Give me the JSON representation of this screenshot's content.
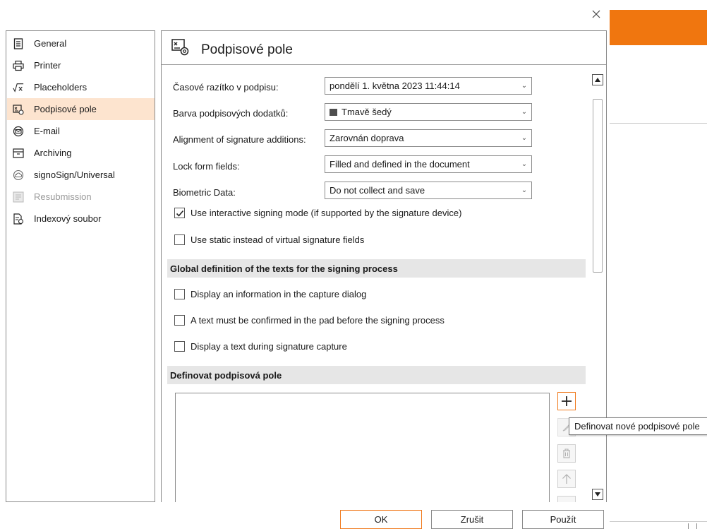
{
  "dialog": {
    "close_label": "×"
  },
  "nav": {
    "items": [
      {
        "label": "General",
        "icon": "general-icon"
      },
      {
        "label": "Printer",
        "icon": "printer-icon"
      },
      {
        "label": "Placeholders",
        "icon": "formula-icon"
      },
      {
        "label": "Podpisové pole",
        "icon": "signature-field-icon",
        "selected": true
      },
      {
        "label": "E-mail",
        "icon": "email-icon"
      },
      {
        "label": "Archiving",
        "icon": "archive-icon"
      },
      {
        "label": "signoSign/Universal",
        "icon": "cloud-icon"
      },
      {
        "label": "Resubmission",
        "icon": "resubmission-icon",
        "disabled": true
      },
      {
        "label": "Indexový soubor",
        "icon": "index-file-icon"
      }
    ]
  },
  "main": {
    "title": "Podpisové pole",
    "fields": {
      "timestamp_label": "Časové razítko v podpisu:",
      "timestamp_value": "pondělí 1. května 2023 11:44:14",
      "color_label": "Barva podpisových dodatků:",
      "color_value": "Tmavě šedý",
      "color_swatch": "#4e4e4e",
      "alignment_label": "Alignment of signature additions:",
      "alignment_value": "Zarovnán doprava",
      "lock_label": "Lock form fields:",
      "lock_value": "Filled and defined in the document",
      "biometric_label": "Biometric Data:",
      "biometric_value": "Do not collect and save"
    },
    "checks": {
      "interactive_label": "Use interactive signing mode (if supported by the signature device)",
      "interactive_checked": true,
      "static_label": "Use static instead of virtual signature fields",
      "static_checked": false
    },
    "global_section": {
      "title": "Global definition of the texts for the signing process",
      "display_info_label": "Display an information in the capture dialog",
      "confirm_text_label": "A text must be confirmed in the pad before the signing process",
      "display_text_label": "Display a text during signature capture"
    },
    "define_section": {
      "title": "Definovat podpisová pole",
      "add_label": "+",
      "tooltip": "Definovat nové podpisové pole"
    }
  },
  "footer": {
    "ok": "OK",
    "cancel": "Zrušit",
    "apply": "Použít"
  },
  "colors": {
    "accent": "#f07a1e",
    "selected_bg": "#fde4cf",
    "background_app_header": "#f0760f"
  }
}
